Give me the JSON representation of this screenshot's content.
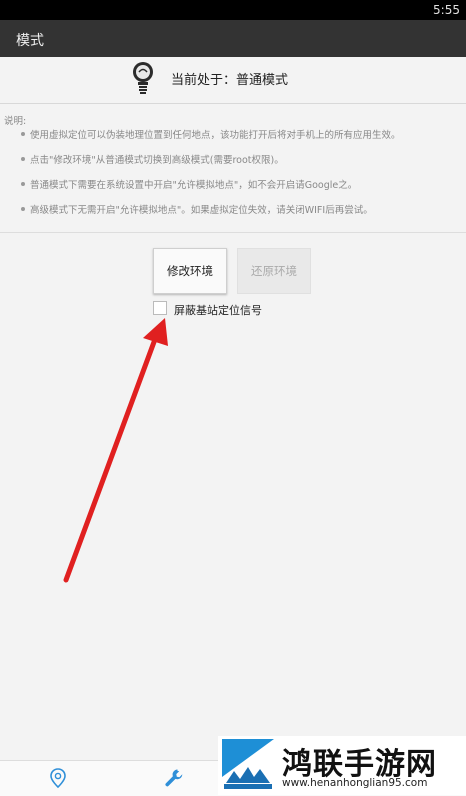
{
  "status_bar": {
    "time": "5:55"
  },
  "action_bar": {
    "title": "模式"
  },
  "mode_header": {
    "text": "当前处于：普通模式",
    "icon": "lightbulb-icon"
  },
  "notes": {
    "label": "说明:",
    "items": [
      "使用虚拟定位可以伪装地理位置到任何地点，该功能打开后将对手机上的所有应用生效。",
      "点击\"修改环境\"从普通模式切换到高级模式(需要root权限)。",
      "普通模式下需要在系统设置中开启\"允许模拟地点\"，如不会开启请Google之。",
      "高级模式下无需开启\"允许模拟地点\"。如果虚拟定位失效，请关闭WIFI后再尝试。"
    ]
  },
  "buttons": {
    "modify": "修改环境",
    "restore": "还原环境"
  },
  "checkbox": {
    "label": "屏蔽基站定位信号",
    "checked": false
  },
  "annotation": {
    "arrow_color": "#e02020"
  },
  "bottom_nav": {
    "items": [
      "location-pin-icon",
      "wrench-icon"
    ],
    "accent": "#2f8fd8"
  },
  "watermark": {
    "title": "鸿联手游网",
    "url": "www.henanhonglian95.com"
  }
}
